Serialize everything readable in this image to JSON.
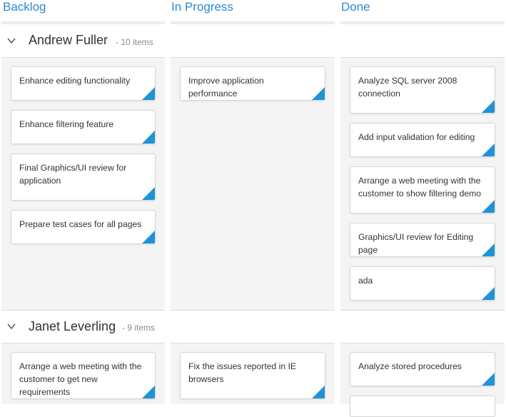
{
  "columns": [
    {
      "title": "Backlog"
    },
    {
      "title": "In Progress"
    },
    {
      "title": "Done"
    }
  ],
  "swimlanes": [
    {
      "name": "Andrew Fuller",
      "count": "- 10 items",
      "backlog": [
        "Enhance editing functionality",
        "Enhance filtering feature",
        "Final Graphics/UI review for application",
        "Prepare test cases for all pages"
      ],
      "in_progress": [
        "Improve application performance"
      ],
      "done": [
        "Analyze SQL server 2008 connection",
        "Add input validation for editing",
        "Arrange a web meeting with the customer to show filtering demo",
        "Graphics/UI review for Editing page",
        "ada"
      ]
    },
    {
      "name": "Janet Leverling",
      "count": "- 9 items",
      "backlog": [
        "Arrange a web meeting with the customer to get new requirements"
      ],
      "in_progress": [
        "Fix the issues reported in IE browsers"
      ],
      "done": [
        "Analyze stored procedures",
        ""
      ]
    }
  ],
  "icons": {
    "collapse": "chevron-down-icon",
    "card_corner": "card-priority-triangle"
  },
  "colors": {
    "accent": "#2e8ad2",
    "card_corner": "#1e93d6",
    "lane_bg": "#f4f4f4"
  }
}
